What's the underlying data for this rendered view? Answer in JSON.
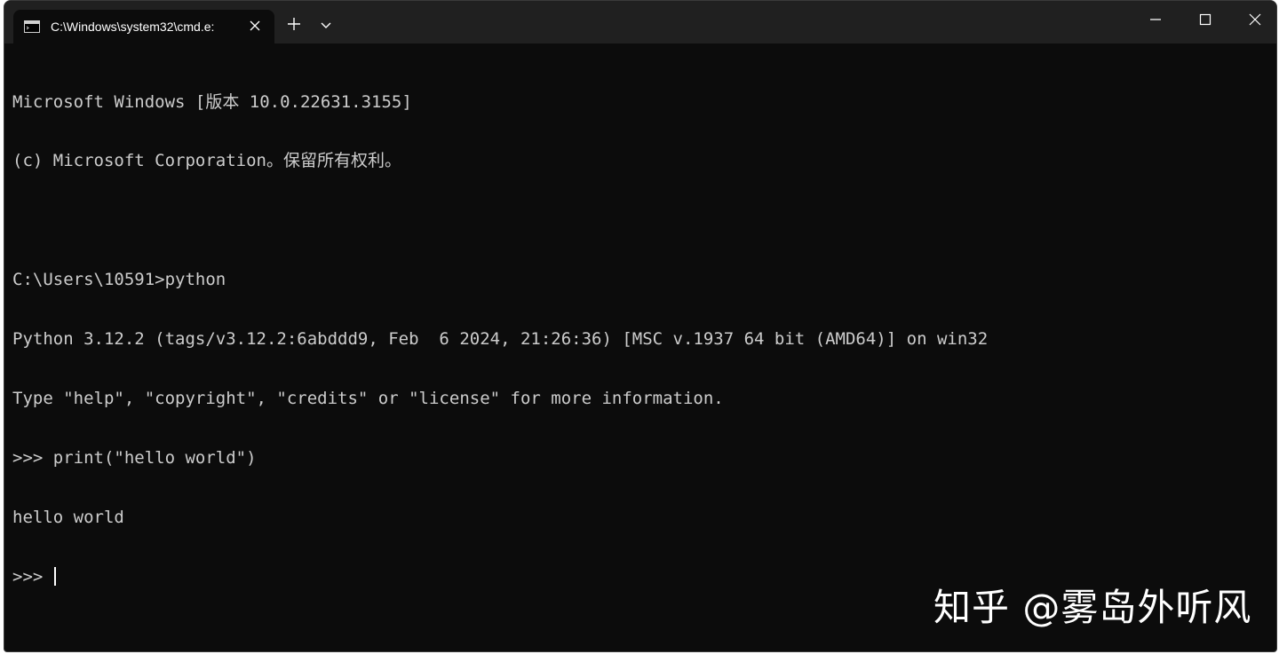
{
  "tab": {
    "title": "C:\\Windows\\system32\\cmd.e:"
  },
  "console": {
    "lines": [
      "Microsoft Windows [版本 10.0.22631.3155]",
      "(c) Microsoft Corporation。保留所有权利。",
      "",
      "C:\\Users\\10591>python",
      "Python 3.12.2 (tags/v3.12.2:6abddd9, Feb  6 2024, 21:26:36) [MSC v.1937 64 bit (AMD64)] on win32",
      "Type \"help\", \"copyright\", \"credits\" or \"license\" for more information.",
      ">>> print(\"hello world\")",
      "hello world"
    ],
    "prompt": ">>> "
  },
  "watermark": {
    "text": "知乎 @雾岛外听风"
  },
  "icons": {
    "tab_icon": "terminal-icon",
    "tab_close": "close-icon",
    "new_tab": "plus-icon",
    "dropdown": "chevron-down-icon",
    "minimize": "minimize-icon",
    "maximize": "maximize-icon",
    "close": "close-icon"
  },
  "colors": {
    "background": "#0c0c0c",
    "titlebar": "#202020",
    "text": "#cccccc"
  }
}
